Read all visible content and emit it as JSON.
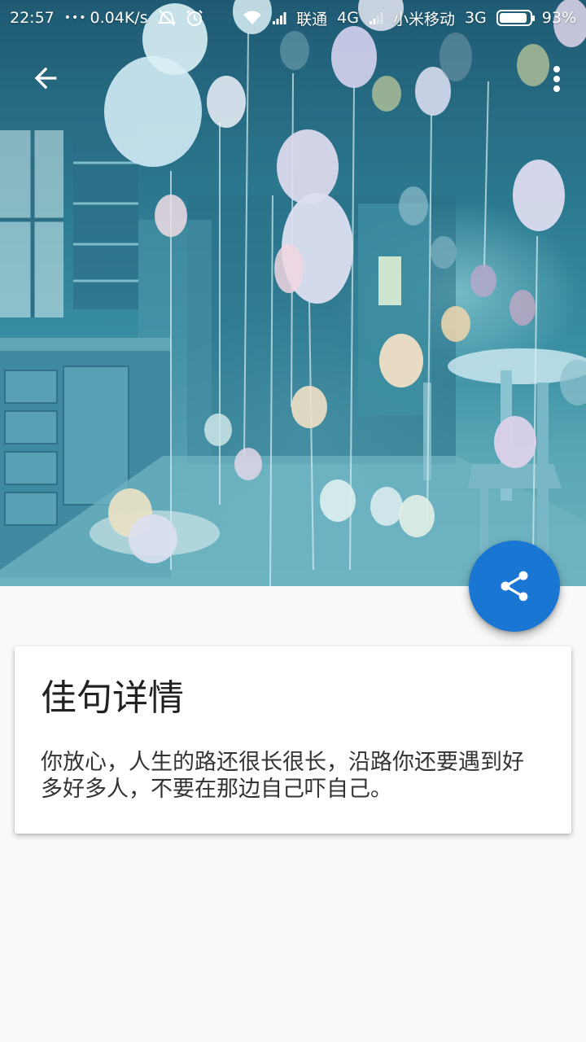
{
  "status_bar": {
    "time": "22:57",
    "dots": "•••",
    "speed": "0.04K/s",
    "carrier1": "联通",
    "network1": "4G",
    "carrier2": "小米移动",
    "network2": "3G",
    "battery_percent": "93%",
    "battery_level": 0.93
  },
  "toolbar": {
    "back_icon": "arrow-back-icon",
    "more_icon": "more-vert-icon"
  },
  "hero": {
    "description_icon": "balloon-kitchen-photo"
  },
  "fab": {
    "icon": "share-icon",
    "color": "#1976d2"
  },
  "card": {
    "title": "佳句详情",
    "content": "你放心，人生的路还很长很长，沿路你还要遇到好多好多人，不要在那边自己吓自己。"
  }
}
